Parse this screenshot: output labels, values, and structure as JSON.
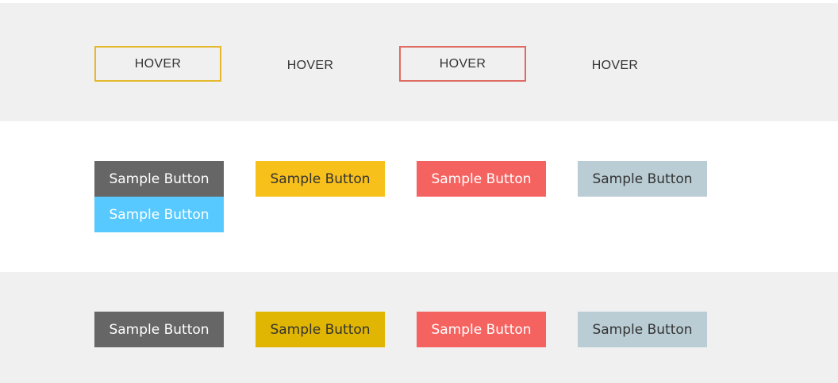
{
  "hover_row": {
    "buttons": [
      {
        "label": "HOVER"
      },
      {
        "label": "HOVER"
      },
      {
        "label": "HOVER"
      },
      {
        "label": "HOVER"
      }
    ]
  },
  "middle_row": {
    "buttons": [
      {
        "label": "Sample Button"
      },
      {
        "label": "Sample Button"
      },
      {
        "label": "Sample Button"
      },
      {
        "label": "Sample Button"
      },
      {
        "label": "Sample Button"
      }
    ]
  },
  "bottom_row": {
    "buttons": [
      {
        "label": "Sample Button"
      },
      {
        "label": "Sample Button"
      },
      {
        "label": "Sample Button"
      },
      {
        "label": "Sample Button"
      }
    ]
  },
  "colors": {
    "band_gray": "#f0f0f0",
    "dark": "#666666",
    "yellow": "#f7c01b",
    "red": "#f56360",
    "gray_blue": "#bacdd4",
    "light_blue": "#57c9ff",
    "mustard": "#e0b602",
    "outline_yellow": "#e5b92d",
    "outline_red": "#e06b63"
  }
}
